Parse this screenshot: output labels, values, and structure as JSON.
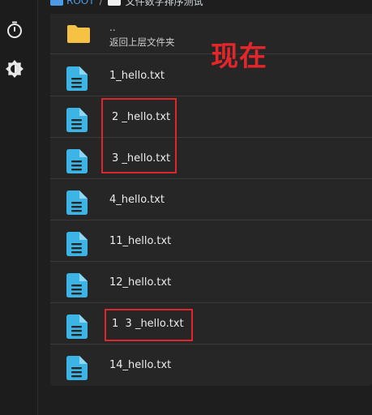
{
  "breadcrumb": {
    "root": "ROOT",
    "separator": "/",
    "folder": "文件数字排序测试"
  },
  "sidebar": {
    "icons": [
      "timer-icon",
      "brightness-icon"
    ]
  },
  "parent_row": {
    "dots": "..",
    "label": "返回上层文件夹"
  },
  "files": [
    {
      "name": "1_hello.txt"
    },
    {
      "name": "2 _hello.txt"
    },
    {
      "name": "3 _hello.txt"
    },
    {
      "name": "4_hello.txt"
    },
    {
      "name": "11_hello.txt"
    },
    {
      "name": "12_hello.txt"
    },
    {
      "name": "1  3 _hello.txt"
    },
    {
      "name": "14_hello.txt"
    }
  ],
  "annotation": {
    "text": "现在",
    "color": "#e4262b"
  },
  "colors": {
    "folder": "#f5c244",
    "file": "#3cb4e6",
    "highlight": "#e0262b"
  }
}
